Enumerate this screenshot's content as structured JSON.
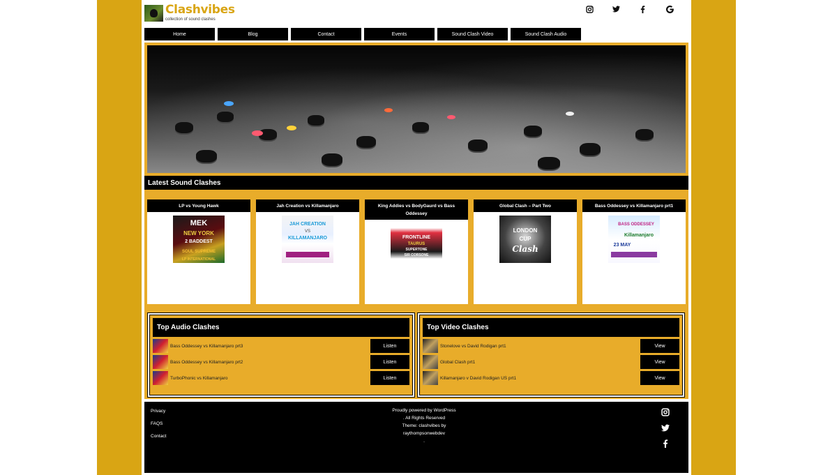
{
  "site": {
    "title": "Clashvibes",
    "tagline": "collection of sound clashes",
    "accent": "#d9a514",
    "panel": "#e8ac2a"
  },
  "social_top": [
    {
      "icon": "instagram-icon",
      "glyph": "◙"
    },
    {
      "icon": "twitter-icon",
      "glyph": "🐦"
    },
    {
      "icon": "facebook-icon",
      "glyph": "f"
    },
    {
      "icon": "google-icon",
      "glyph": "G"
    }
  ],
  "nav": [
    "Home",
    "Blog",
    "Contact",
    "Events",
    "Sound Clash Video",
    "Sound Clash Audio"
  ],
  "latest": {
    "heading": "Latest Sound Clashes",
    "cards": [
      {
        "title": "LP vs Young Hawk",
        "poster_text": "MEK NEW YORK 2 BADDEST SOUL SUPREME LP INTERNATIONAL"
      },
      {
        "title": "Jah Creation vs Killamanjaro",
        "poster_text": "JAH CREATION VS KILLAMANJARO"
      },
      {
        "title": "King Addies vs BodyGaurd vs Bass Oddessey",
        "poster_text": "FRONTLINE TAURUS SOPRANO B SUPERTONE SIR CORSONE HERBIE RENEGADE"
      },
      {
        "title": "Global Clash – Part Two",
        "poster_text": "LONDON CUP Clash"
      },
      {
        "title": "Bass Oddessey vs Killamanjaro prt1",
        "poster_text": "BASS ODDESSEY Killamanjaro 23 MAY"
      }
    ]
  },
  "top_audio": {
    "heading": "Top Audio Clashes",
    "rows": [
      {
        "label": "Bass Oddessey vs Killamanjaro prt3",
        "button": "Listen"
      },
      {
        "label": "Bass Oddessey vs Killamanjaro prt2",
        "button": "Listen"
      },
      {
        "label": "TurboPhonic vs Killamanjaro",
        "button": "Listen"
      }
    ]
  },
  "top_video": {
    "heading": "Top Video Clashes",
    "rows": [
      {
        "label": "Stonelove vs David Rodigan prt1",
        "button": "View"
      },
      {
        "label": "Global Clash prt1",
        "button": "View"
      },
      {
        "label": "Killamanjaro v David Rodigan US prt1",
        "button": "View"
      }
    ]
  },
  "footer": {
    "links": [
      "Privacy",
      "FAQS",
      "Contact"
    ],
    "powered": "Proudly powered by WordPress",
    "rights": ". All Rights Reserved",
    "theme": "Theme: clashvibes by",
    "author": "raythompsonwebdev",
    "dot": ".",
    "social": [
      {
        "icon": "instagram-icon",
        "glyph": "◙"
      },
      {
        "icon": "twitter-icon",
        "glyph": "🐦"
      },
      {
        "icon": "facebook-icon",
        "glyph": "f"
      }
    ]
  }
}
